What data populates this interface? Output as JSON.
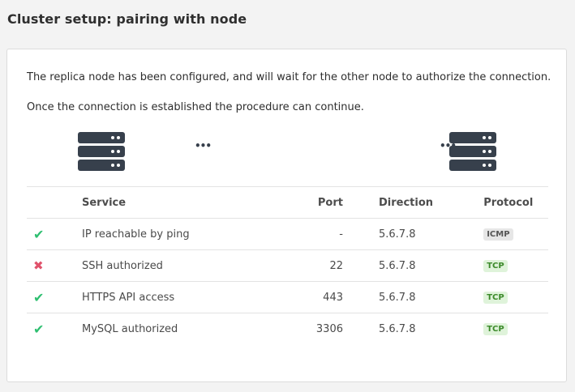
{
  "page": {
    "title": "Cluster setup: pairing with node"
  },
  "card": {
    "message_1": "The replica node has been configured, and will wait for the other node to authorize the connection.",
    "message_2": "Once the connection is established the procedure can continue.",
    "connector_dots_mid": "•••",
    "connector_dots_right": "•••"
  },
  "table": {
    "headers": {
      "service": "Service",
      "port": "Port",
      "direction": "Direction",
      "protocol": "Protocol"
    },
    "rows": [
      {
        "status": "ok",
        "status_glyph": "✔",
        "service": "IP reachable by ping",
        "port": "-",
        "direction": "5.6.7.8",
        "protocol": "ICMP"
      },
      {
        "status": "fail",
        "status_glyph": "✖",
        "service": "SSH authorized",
        "port": "22",
        "direction": "5.6.7.8",
        "protocol": "TCP"
      },
      {
        "status": "ok",
        "status_glyph": "✔",
        "service": "HTTPS API access",
        "port": "443",
        "direction": "5.6.7.8",
        "protocol": "TCP"
      },
      {
        "status": "ok",
        "status_glyph": "✔",
        "service": "MySQL authorized",
        "port": "3306",
        "direction": "5.6.7.8",
        "protocol": "TCP"
      }
    ]
  },
  "colors": {
    "ok": "#2fbf71",
    "fail": "#e0526b",
    "server": "#37404c",
    "badge_tcp_bg": "#dff3da",
    "badge_icmp_bg": "#e6e6e6"
  },
  "icons": {
    "server_left": "server-icon",
    "server_right": "server-icon",
    "ok": "check-icon",
    "fail": "cross-icon"
  }
}
